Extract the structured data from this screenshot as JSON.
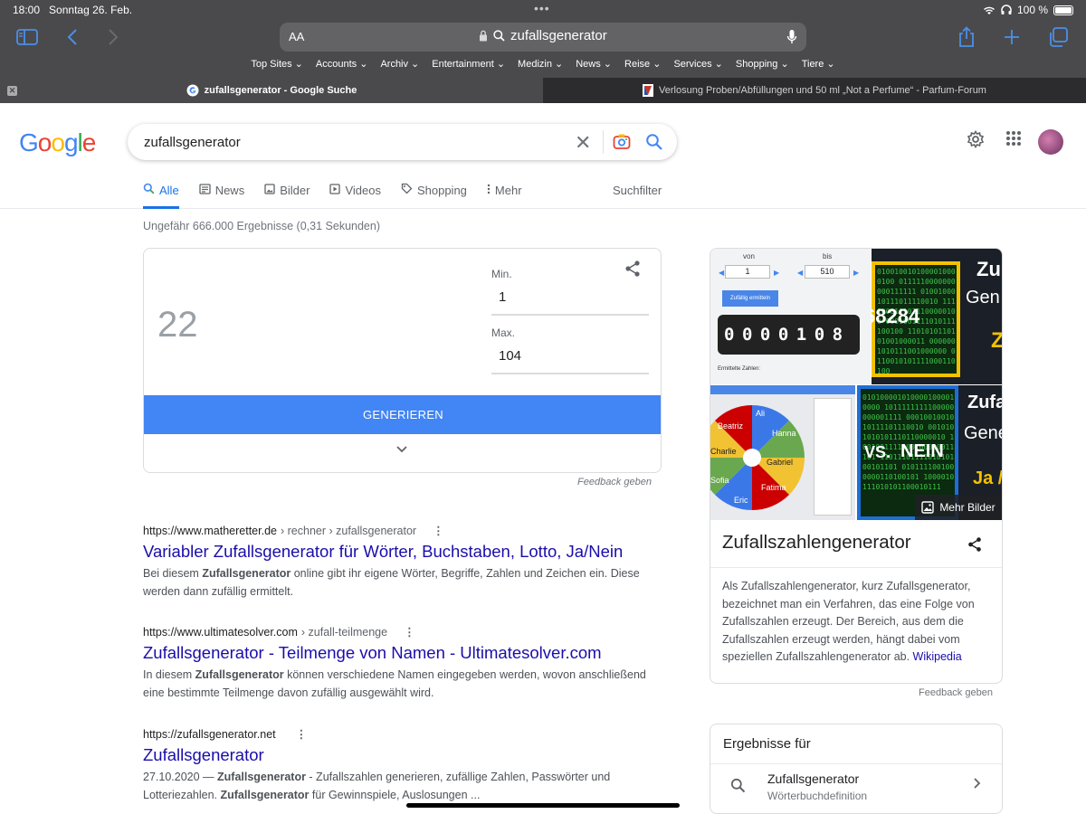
{
  "status": {
    "time": "18:00",
    "date": "Sonntag 26. Feb.",
    "battery": "100 %"
  },
  "browser": {
    "aa_label": "AA",
    "url_text": "zufallsgenerator",
    "favorites": [
      "Top Sites",
      "Accounts",
      "Archiv",
      "Entertainment",
      "Medizin",
      "News",
      "Reise",
      "Services",
      "Shopping",
      "Tiere"
    ],
    "tabs": [
      {
        "title": "zufallsgenerator - Google Suche"
      },
      {
        "title": "Verlosung Proben/Abfüllungen und 50 ml „Not a Perfume“ - Parfum-Forum"
      }
    ],
    "accent": "#4a8fe8"
  },
  "google": {
    "logo": "Google",
    "query": "zufallsgenerator",
    "nav": [
      {
        "label": "Alle",
        "icon": "search-icon",
        "active": true
      },
      {
        "label": "News",
        "icon": "news-icon"
      },
      {
        "label": "Bilder",
        "icon": "image-icon"
      },
      {
        "label": "Videos",
        "icon": "video-icon"
      },
      {
        "label": "Shopping",
        "icon": "tag-icon"
      },
      {
        "label": "Mehr",
        "icon": "more-vert-icon"
      }
    ],
    "suchfilter": "Suchfilter",
    "stats": "Ungefähr 666.000 Ergebnisse (0,31 Sekunden)"
  },
  "rng": {
    "number": "22",
    "min_label": "Min.",
    "min_value": "1",
    "max_label": "Max.",
    "max_value": "104",
    "button": "GENERIEREN",
    "feedback": "Feedback geben"
  },
  "results": [
    {
      "domain": "https://www.matheretter.de",
      "path": " › rechner › zufallsgenerator",
      "title": "Variabler Zufallsgenerator für Wörter, Buchstaben, Lotto, Ja/Nein",
      "snippet_parts": [
        "Bei diesem ",
        "Zufallsgenerator",
        " online gibt ihr eigene Wörter, Begriffe, Zahlen und Zeichen ein. Diese werden dann zufällig ermittelt."
      ]
    },
    {
      "domain": "https://www.ultimatesolver.com",
      "path": " › zufall-teilmenge",
      "title": "Zufallsgenerator - Teilmenge von Namen - Ultimatesolver.com",
      "snippet_parts": [
        "In diesem ",
        "Zufallsgenerator",
        " können verschiedene Namen eingegeben werden, wovon anschließend eine bestimmte Teilmenge davon zufällig ausgewählt wird."
      ]
    },
    {
      "domain": "https://zufallsgenerator.net",
      "path": "",
      "title": "Zufallsgenerator",
      "snippet_parts": [
        "27.10.2020 — ",
        "Zufallsgenerator",
        " - Zufallszahlen generieren, zufällige Zahlen, Passwörter und Lotteriezahlen. ",
        "Zufallsgenerator",
        " für Gewinnspiele, Auslosungen ..."
      ]
    }
  ],
  "knowledge": {
    "title": "Zufallszahlengenerator",
    "mehr_bilder": "Mehr Bilder",
    "description": "Als Zufallszahlengenerator, kurz Zufallsgenerator, bezeichnet man ein Verfahren, das eine Folge von Zufallszahlen erzeugt. Der Bereich, aus dem die Zufallszahlen erzeugt werden, hängt dabei vom speziellen Zufallszahlengenerator ab. ",
    "source": "Wikipedia",
    "feedback": "Feedback geben",
    "images": {
      "img1_von": "von",
      "img1_bis": "bis",
      "img1_min": "1",
      "img1_max": "510",
      "img1_button": "Zufällig ermitteln",
      "img1_digits": "0000108",
      "img1_label": "Ermittelte Zahlen:",
      "img2_text1": "Zu",
      "img2_text2": "Gen",
      "img2_text3": "Z",
      "img2_number": "68284",
      "img3_names": [
        "Ali",
        "Hanna",
        "Gabriel",
        "Fatima",
        "Eric",
        "Sofia",
        "Charlie",
        "Beatriz"
      ],
      "img4_text1": "Zufa",
      "img4_text2": "Gene",
      "img4_vs": "VS.",
      "img4_nein": "NEIN",
      "img4_ja": "Ja /"
    }
  },
  "ergebnisse": {
    "header": "Ergebnisse für",
    "term": "Zufallsgenerator",
    "sub": "Wörterbuchdefinition"
  }
}
